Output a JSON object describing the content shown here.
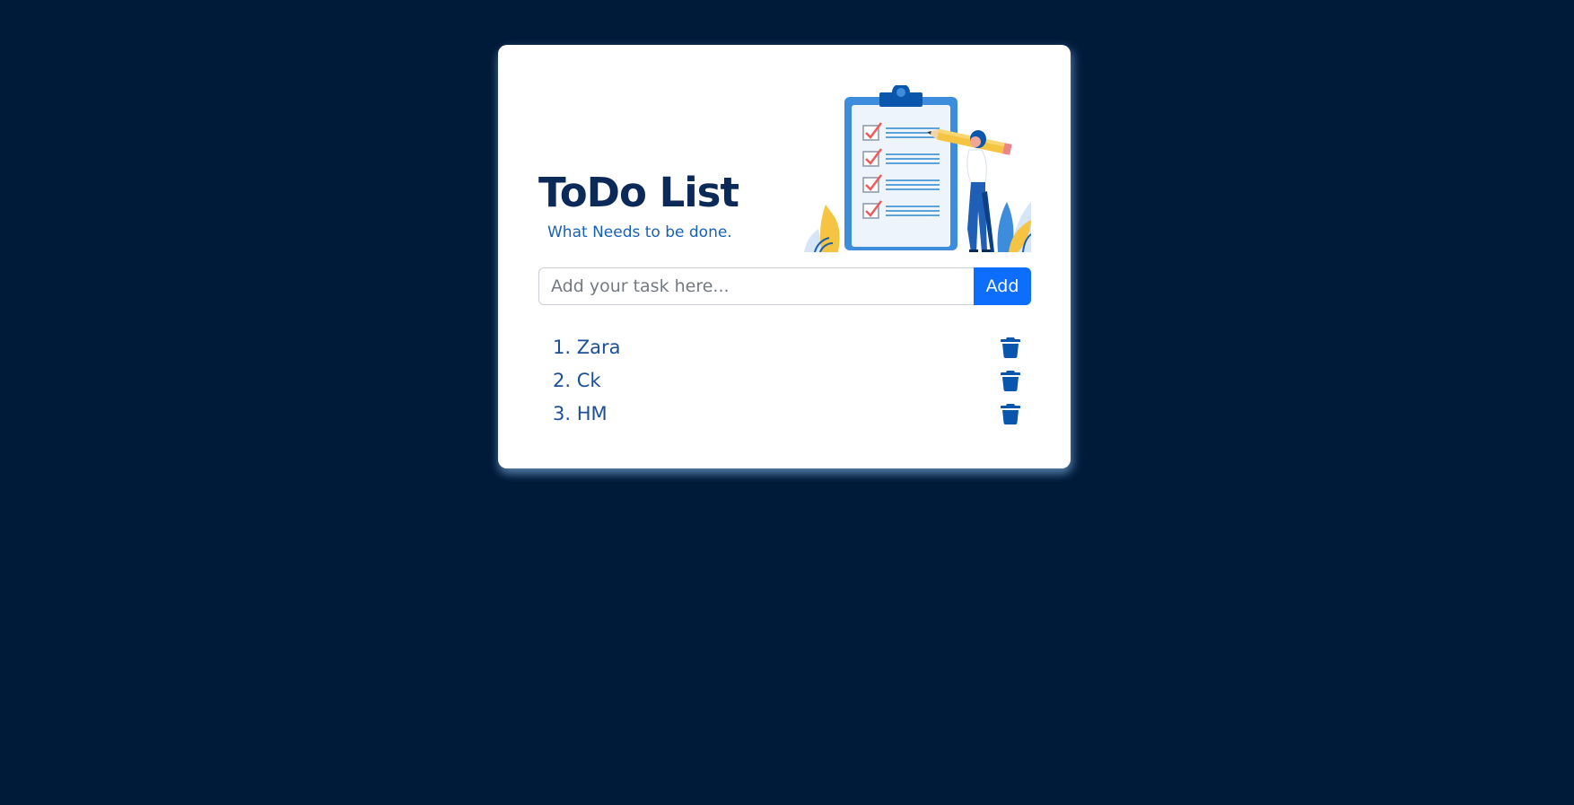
{
  "app": {
    "title": "ToDo List",
    "subtitle": "What Needs to be done."
  },
  "input": {
    "placeholder": "Add your task here...",
    "value": "",
    "add_label": "Add"
  },
  "tasks": [
    {
      "label": "1. Zara"
    },
    {
      "label": "2. Ck"
    },
    {
      "label": "3. HM"
    }
  ],
  "icons": {
    "delete": "trash-icon",
    "illustration": "clipboard-checklist-illustration"
  },
  "colors": {
    "background": "#001a3a",
    "card": "#ffffff",
    "title": "#0b2a57",
    "subtitle": "#1661b8",
    "accent": "#0d6efd",
    "task_text": "#1b4f97",
    "trash": "#0b56ad"
  }
}
